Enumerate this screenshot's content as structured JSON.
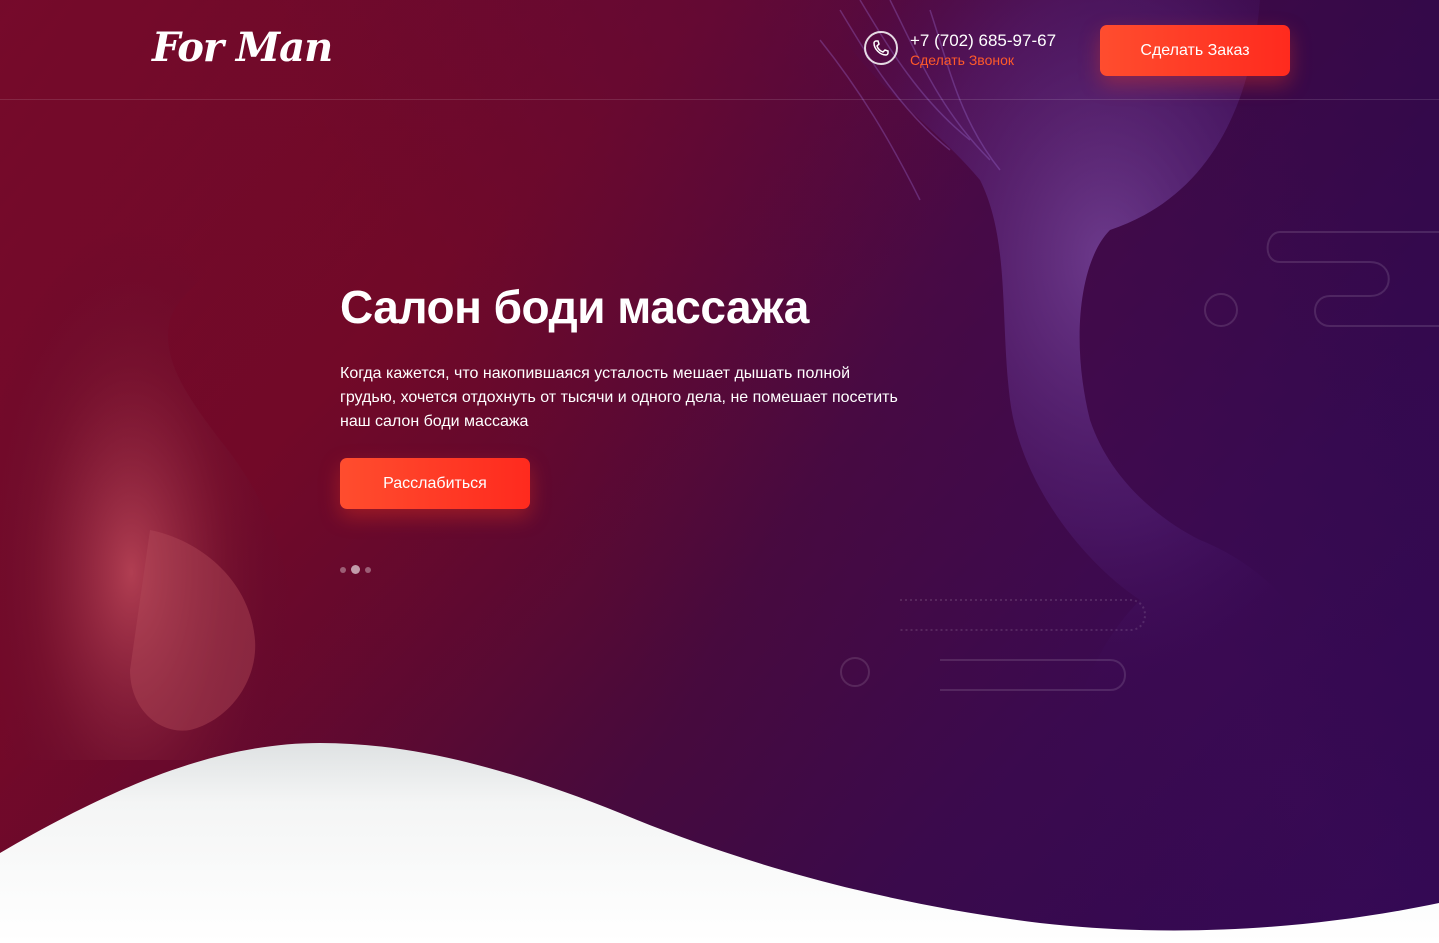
{
  "header": {
    "logo": "For Man",
    "phone": "+7 (702) 685-97-67",
    "callback": "Сделать Звонок",
    "order_button": "Сделать Заказ"
  },
  "hero": {
    "title": "Салон боди массажа",
    "text": "Когда кажется, что накопившаяся усталость мешает дышать полной грудью, хочется отдохнуть от тысячи и одного дела, не помешает посетить наш салон боди массажа",
    "button": "Расслабиться",
    "slides_active": 2,
    "slides_total": 3
  },
  "colors": {
    "accent": "#ff4d2e",
    "link": "#ff5a2a",
    "text": "#ffffff",
    "wave": "#f2f3f3"
  },
  "icons": {
    "phone": "phone-icon"
  }
}
